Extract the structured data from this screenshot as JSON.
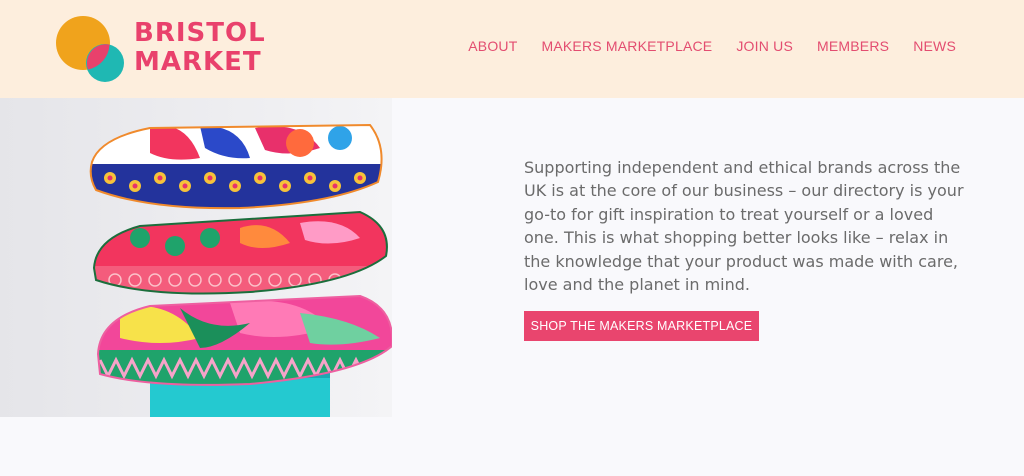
{
  "brand": {
    "logo_line1": "BRISTOL",
    "logo_line2": "MARKET",
    "colors": {
      "primary": "#e9416c",
      "orange": "#f0a31c",
      "teal": "#1fb8b3",
      "header_bg": "#fdeedd"
    }
  },
  "nav": {
    "items": [
      {
        "label": "ABOUT"
      },
      {
        "label": "MAKERS MARKETPLACE"
      },
      {
        "label": "JOIN US"
      },
      {
        "label": "MEMBERS"
      },
      {
        "label": "NEWS"
      }
    ]
  },
  "hero": {
    "image_subject": "stacked patterned cushions",
    "description": "Supporting independent and ethical brands across the UK is at the core of our business – our directory is your go-to for gift inspiration to treat yourself or a loved one. This is what shopping better looks like – relax in the knowledge that your product was made with care, love and the planet in mind.",
    "cta_label": "SHOP THE MAKERS MARKETPLACE"
  }
}
